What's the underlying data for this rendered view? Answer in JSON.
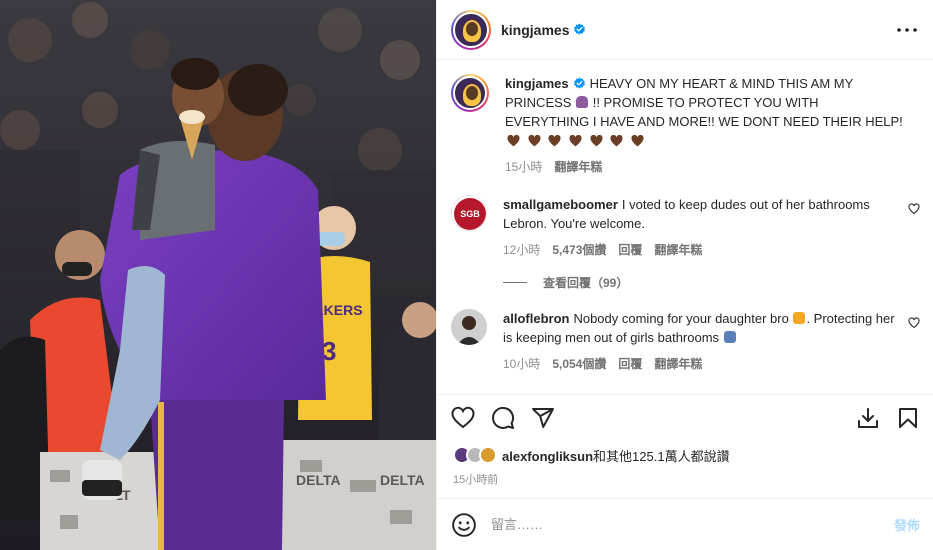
{
  "post": {
    "username": "kingjames",
    "more_icon": "more-horizontal-icon"
  },
  "caption": {
    "username": "kingjames",
    "text_part1": "HEAVY ON MY HEART & MIND THIS AM MY PRINCESS",
    "text_part2": "!! PROMISE TO PROTECT YOU WITH EVERYTHING I HAVE AND MORE!! WE DONT NEED THEIR HELP!",
    "time": "15小時",
    "translate": "翻譯年糕"
  },
  "comments": [
    {
      "username": "smallgameboomer",
      "text": "I voted to keep dudes out of her bathrooms Lebron. You're welcome.",
      "time": "12小時",
      "likes": "5,473個讚",
      "reply": "回覆",
      "translate": "翻譯年糕",
      "avatar_label": "SGB"
    },
    {
      "username": "alloflebron",
      "text_part1": "Nobody coming for your daughter bro",
      "text_part2": ". Protecting her is keeping men out of girls bathrooms",
      "time": "10小時",
      "likes": "5,054個讚",
      "reply": "回覆",
      "translate": "翻譯年糕"
    }
  ],
  "view_replies": "查看回覆（99）",
  "likes": {
    "user": "alexfongliksun",
    "rest": "和其他125.1萬人都說讚"
  },
  "time_ago": "15小時前",
  "add_comment": {
    "placeholder": "留言……",
    "post_label": "發佈"
  },
  "colors": {
    "lakers_purple": "#552583",
    "lakers_gold": "#FDB927",
    "verified_blue": "#0095f6",
    "muted": "#8e8e8e"
  }
}
